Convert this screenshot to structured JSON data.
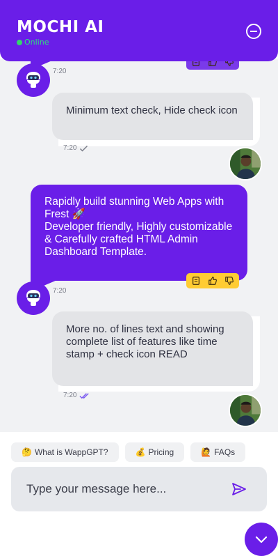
{
  "header": {
    "title": "MOCHI AI",
    "status": "Online",
    "minimize_icon": "minus-circle-icon"
  },
  "messages": [
    {
      "sender": "bot",
      "text": "",
      "time": "7:20",
      "actions": [
        "copy-icon",
        "thumbs-up-icon",
        "thumbs-down-icon"
      ]
    },
    {
      "sender": "user",
      "text": "Minimum text check, Hide check icon",
      "time": "7:20",
      "check": "single"
    },
    {
      "sender": "bot",
      "text": "Rapidly build stunning Web Apps with Frest 🚀\nDeveloper friendly, Highly customizable & Carefully crafted HTML Admin Dashboard Template.",
      "time": "7:20",
      "actions": [
        "copy-icon",
        "thumbs-up-icon",
        "thumbs-down-icon"
      ]
    },
    {
      "sender": "user",
      "text": "More no. of lines text and showing complete list of features like time stamp + check icon READ",
      "time": "7:20",
      "check": "double-read"
    }
  ],
  "quick_replies": [
    {
      "emoji": "🤔",
      "label": "What is WappGPT?"
    },
    {
      "emoji": "💰",
      "label": "Pricing"
    },
    {
      "emoji": "🙋",
      "label": "FAQs"
    }
  ],
  "composer": {
    "placeholder": "Type your message here...",
    "send_icon": "send-icon"
  },
  "fab_icon": "chevron-down-icon",
  "colors": {
    "primary": "#6a1ee8",
    "online": "#2de37c",
    "user_bubble": "#e3e4e7",
    "actions_bg": "#ffcc33",
    "read_check": "#7b5cf0"
  }
}
